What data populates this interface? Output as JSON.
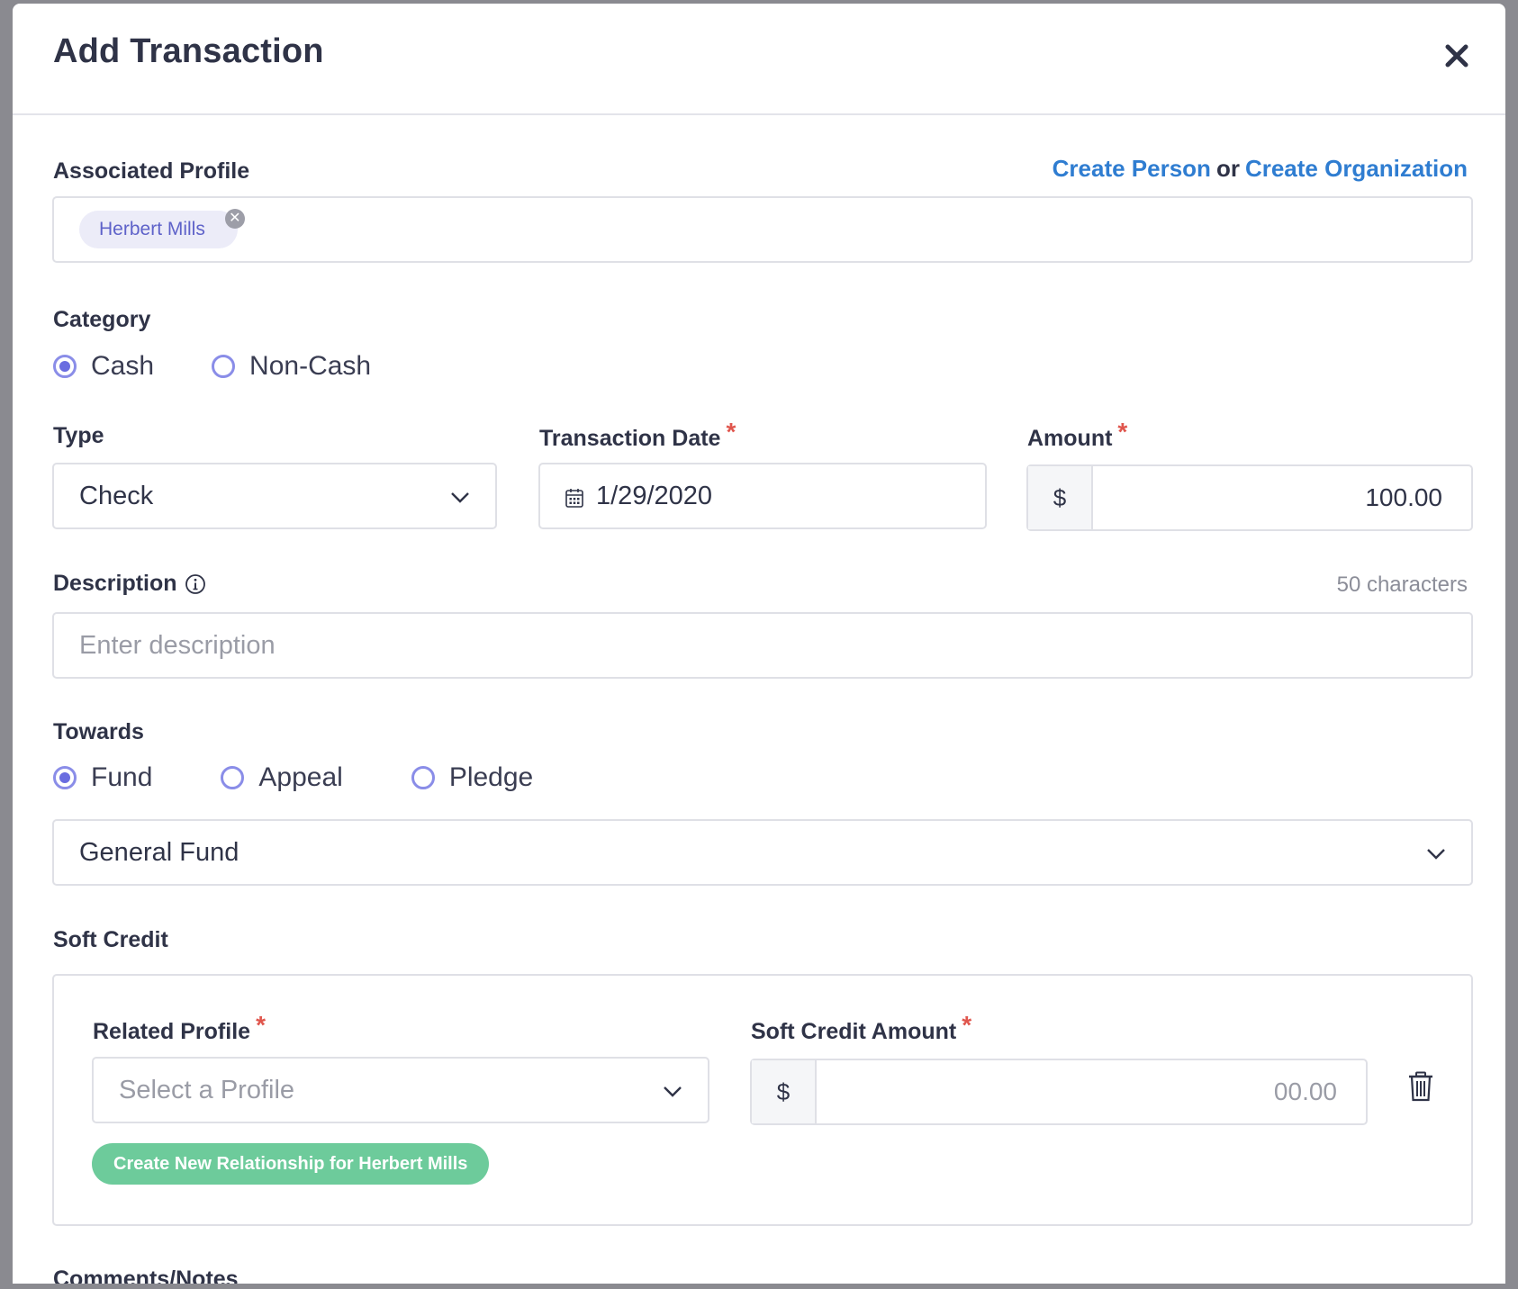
{
  "modal": {
    "title": "Add Transaction"
  },
  "associated_profile": {
    "label": "Associated Profile",
    "create_person": "Create Person",
    "or": "or",
    "create_organization": "Create Organization",
    "selected_chip": "Herbert Mills"
  },
  "category": {
    "label": "Category",
    "options": [
      "Cash",
      "Non-Cash"
    ],
    "selected": "Cash"
  },
  "type": {
    "label": "Type",
    "value": "Check"
  },
  "transaction_date": {
    "label": "Transaction Date",
    "value": "1/29/2020"
  },
  "amount": {
    "label": "Amount",
    "currency": "$",
    "value": "100.00"
  },
  "description": {
    "label": "Description",
    "char_count": "50 characters",
    "placeholder": "Enter description"
  },
  "towards": {
    "label": "Towards",
    "options": [
      "Fund",
      "Appeal",
      "Pledge"
    ],
    "selected": "Fund",
    "fund_value": "General Fund"
  },
  "soft_credit": {
    "label": "Soft Credit",
    "related_profile_label": "Related Profile",
    "related_profile_placeholder": "Select a Profile",
    "amount_label": "Soft Credit Amount",
    "currency": "$",
    "amount_placeholder": "00.00",
    "create_relationship_button": "Create New Relationship for Herbert Mills"
  },
  "comments": {
    "label": "Comments/Notes"
  },
  "required_marker": "*"
}
